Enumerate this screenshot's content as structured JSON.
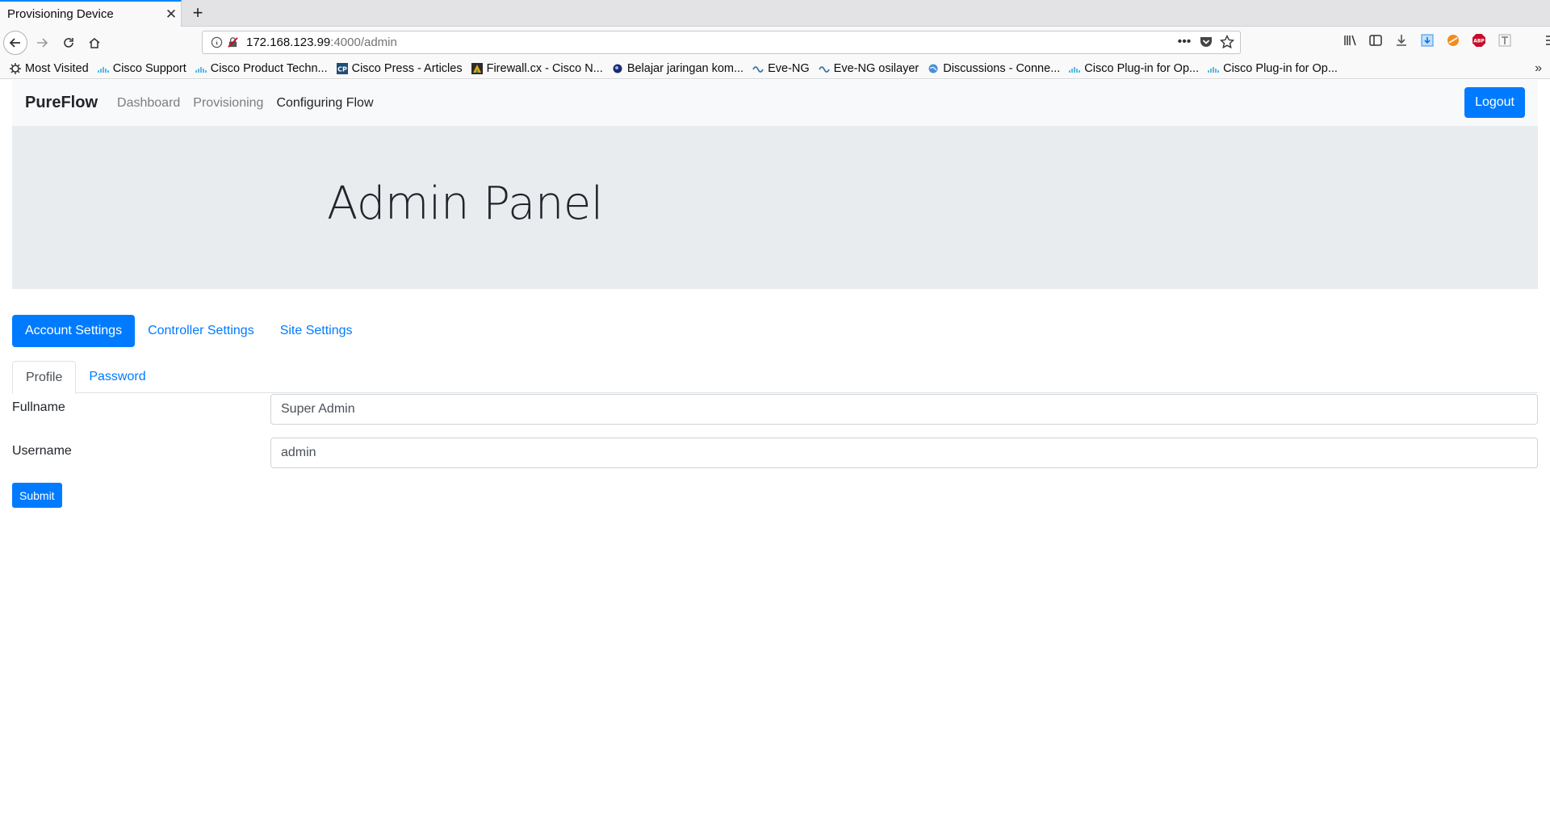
{
  "browser": {
    "tab_title": "Provisioning Device",
    "url_host": "172.168.123.99",
    "url_path": ":4000/admin",
    "bookmarks": [
      "Most Visited",
      "Cisco Support",
      "Cisco Product Techn...",
      "Cisco Press - Articles",
      "Firewall.cx - Cisco N...",
      "Belajar jaringan kom...",
      "Eve-NG",
      "Eve-NG osilayer",
      "Discussions - Conne...",
      "Cisco Plug-in for Op...",
      "Cisco Plug-in for Op..."
    ]
  },
  "app": {
    "brand": "PureFlow",
    "menu": [
      "Dashboard",
      "Provisioning",
      "Configuring Flow"
    ],
    "logout_label": "Logout"
  },
  "hero": {
    "title": "Admin Panel"
  },
  "settings_pills": [
    "Account Settings",
    "Controller Settings",
    "Site Settings"
  ],
  "subtabs": [
    "Profile",
    "Password"
  ],
  "form": {
    "fullname_label": "Fullname",
    "fullname_value": "Super Admin",
    "username_label": "Username",
    "username_value": "admin",
    "submit_label": "Submit"
  },
  "colors": {
    "primary": "#007bff",
    "nav_bg": "#f8f9fa",
    "jumbotron_bg": "#e9ecef"
  }
}
